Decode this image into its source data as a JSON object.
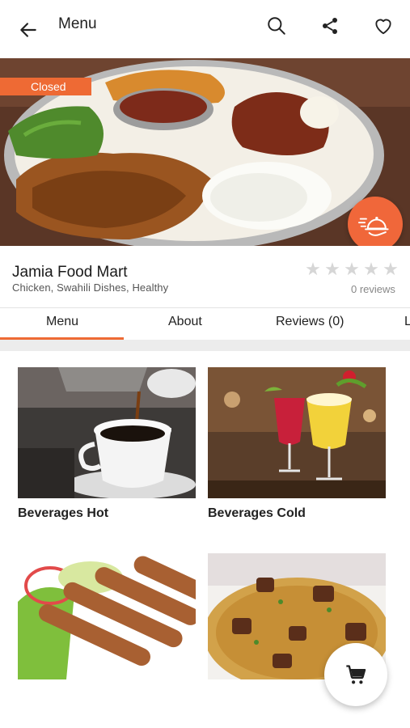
{
  "appbar": {
    "title": "Menu",
    "icons": [
      "back-arrow-icon",
      "search-icon",
      "share-icon",
      "heart-icon"
    ]
  },
  "hero": {
    "status_badge": "Closed",
    "delivery_icon": "delivery-cloche-icon"
  },
  "store": {
    "name": "Jamia Food Mart",
    "categories": "Chicken, Swahili Dishes, Healthy",
    "rating_stars": 0,
    "reviews_text": "0 reviews"
  },
  "tabs": [
    {
      "label": "Menu",
      "active": true
    },
    {
      "label": "About",
      "active": false
    },
    {
      "label": "Reviews (0)",
      "active": false
    },
    {
      "label": "L",
      "active": false
    }
  ],
  "menu_items": [
    {
      "label": "Beverages Hot"
    },
    {
      "label": "Beverages Cold"
    },
    {
      "label": ""
    },
    {
      "label": ""
    }
  ],
  "cart": {
    "icon": "cart-icon"
  },
  "colors": {
    "accent": "#ee6a34",
    "fab": "#f0673a",
    "star_empty": "#d6d6d6"
  }
}
